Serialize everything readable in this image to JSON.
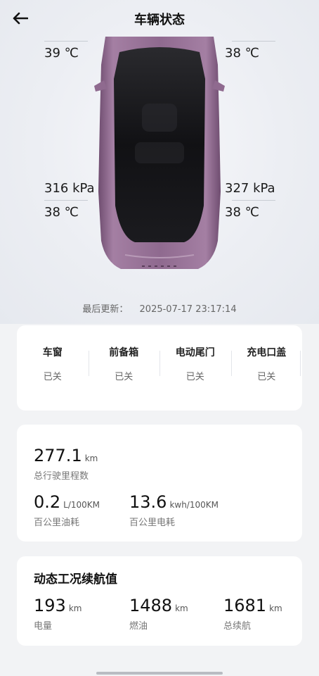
{
  "header": {
    "title": "车辆状态"
  },
  "tires": {
    "front_left": {
      "temp": "39 ℃"
    },
    "front_right": {
      "temp": "38 ℃"
    },
    "rear_left": {
      "pressure": "316 kPa",
      "temp": "38 ℃"
    },
    "rear_right": {
      "pressure": "327 kPa",
      "temp": "38 ℃"
    }
  },
  "update": {
    "label": "最后更新：",
    "time": "2025-07-17 23:17:14"
  },
  "status": [
    {
      "label": "车窗",
      "value": "已关"
    },
    {
      "label": "前备箱",
      "value": "已关"
    },
    {
      "label": "电动尾门",
      "value": "已关"
    },
    {
      "label": "充电口盖",
      "value": "已关"
    }
  ],
  "stats": {
    "mileage": {
      "value": "277.1",
      "unit": "km",
      "label": "总行驶里程数"
    },
    "fuel": {
      "value": "0.2",
      "unit": "L/100KM",
      "label": "百公里油耗"
    },
    "power": {
      "value": "13.6",
      "unit": "kwh/100KM",
      "label": "百公里电耗"
    }
  },
  "range": {
    "title": "动态工况续航值",
    "items": [
      {
        "value": "193",
        "unit": "km",
        "label": "电量"
      },
      {
        "value": "1488",
        "unit": "km",
        "label": "燃油"
      },
      {
        "value": "1681",
        "unit": "km",
        "label": "总续航"
      }
    ]
  },
  "colors": {
    "car_body": "#8a6289",
    "roof": "#1c1c1f",
    "card": "#ffffff"
  }
}
